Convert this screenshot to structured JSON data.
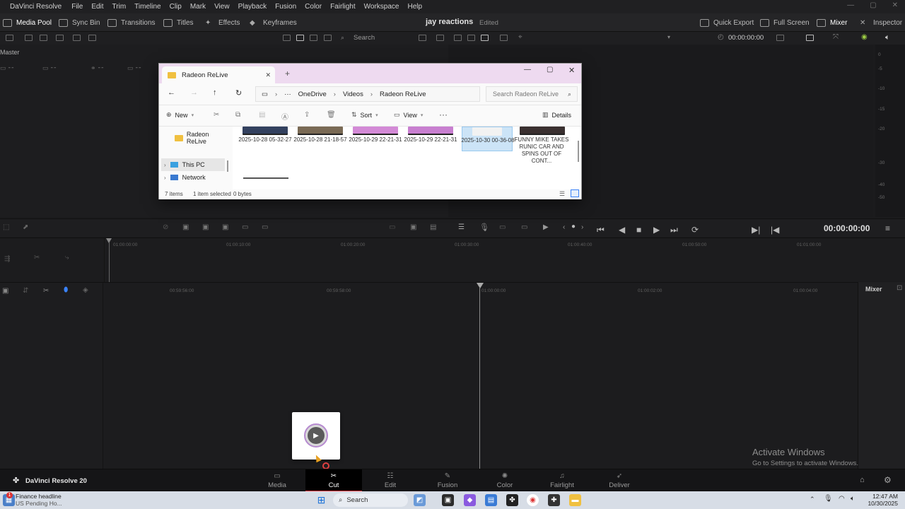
{
  "app": {
    "title": "DaVinci Resolve",
    "menus": [
      "File",
      "Edit",
      "Trim",
      "Timeline",
      "Clip",
      "Mark",
      "View",
      "Playback",
      "Fusion",
      "Color",
      "Fairlight",
      "Workspace",
      "Help"
    ]
  },
  "toolbar": {
    "media_pool": "Media Pool",
    "sync_bin": "Sync Bin",
    "transitions": "Transitions",
    "titles": "Titles",
    "effects": "Effects",
    "keyframes": "Keyframes",
    "project_title": "jay reactions",
    "project_status": "Edited",
    "quick_export": "Quick Export",
    "full_screen": "Full Screen",
    "mixer": "Mixer",
    "inspector": "Inspector"
  },
  "subtoolbar": {
    "search_label": "Search",
    "viewer_timecode": "00:00:00:00"
  },
  "media_pool": {
    "bin_label": "Master"
  },
  "audio_meter": {
    "ticks": [
      "0",
      "-5",
      "-10",
      "-15",
      "-20",
      "-30",
      "-40",
      "-50"
    ]
  },
  "transport": {
    "timecode": "00:00:00:00"
  },
  "upper_ruler": [
    "01:00:00:00",
    "01:00:10:00",
    "01:00:20:00",
    "01:00:30:00",
    "01:00:40:00",
    "01:00:50:00",
    "01:01:00:00"
  ],
  "lower_ruler": [
    "00:59:56:00",
    "00:59:58:00",
    "01:00:00:00",
    "01:00:02:00",
    "01:00:04:00"
  ],
  "mixer_panel": {
    "title": "Mixer"
  },
  "pages": [
    {
      "label": "Media",
      "icon": "media-page-icon",
      "active": false
    },
    {
      "label": "Cut",
      "icon": "cut-page-icon",
      "active": true
    },
    {
      "label": "Edit",
      "icon": "edit-page-icon",
      "active": false
    },
    {
      "label": "Fusion",
      "icon": "fusion-page-icon",
      "active": false
    },
    {
      "label": "Color",
      "icon": "color-page-icon",
      "active": false
    },
    {
      "label": "Fairlight",
      "icon": "fairlight-page-icon",
      "active": false
    },
    {
      "label": "Deliver",
      "icon": "deliver-page-icon",
      "active": false
    }
  ],
  "brand": {
    "label": "DaVinci Resolve 20"
  },
  "explorer": {
    "tab_title": "Radeon ReLive",
    "breadcrumb": [
      "OneDrive",
      "Videos",
      "Radeon ReLive"
    ],
    "search_placeholder": "Search Radeon ReLive",
    "commands": {
      "new": "New",
      "sort": "Sort",
      "view": "View",
      "details": "Details"
    },
    "sidebar": [
      "Radeon ReLive",
      "This PC",
      "Network"
    ],
    "files": [
      {
        "name": "2025-10-28 05-32-27",
        "thumb": "#33415f",
        "selected": false
      },
      {
        "name": "2025-10-28 21-18-57",
        "thumb": "#7a6a55",
        "selected": false
      },
      {
        "name": "2025-10-29 22-21-31",
        "thumb": "#d38ad6",
        "selected": false
      },
      {
        "name": "2025-10-29 22-21-31",
        "thumb": "#c87fd0",
        "selected": false
      },
      {
        "name": "2025-10-30 00-36-08",
        "thumb": "#f2f2f2",
        "selected": true
      },
      {
        "name": "FUNNY MIKE TAKES RUNIC CAR AND SPINS OUT OF CONT...",
        "thumb": "#3a3030",
        "selected": false
      }
    ],
    "status": {
      "count": "7 items",
      "selection": "1 item selected",
      "size": "0 bytes"
    }
  },
  "activate_windows": {
    "title": "Activate Windows",
    "subtitle": "Go to Settings to activate Windows."
  },
  "taskbar": {
    "news_title": "Finance headline",
    "news_sub": "US Pending Ho...",
    "search_label": "Search",
    "time": "12:47 AM",
    "date": "10/30/2025",
    "notification_count": "1"
  }
}
